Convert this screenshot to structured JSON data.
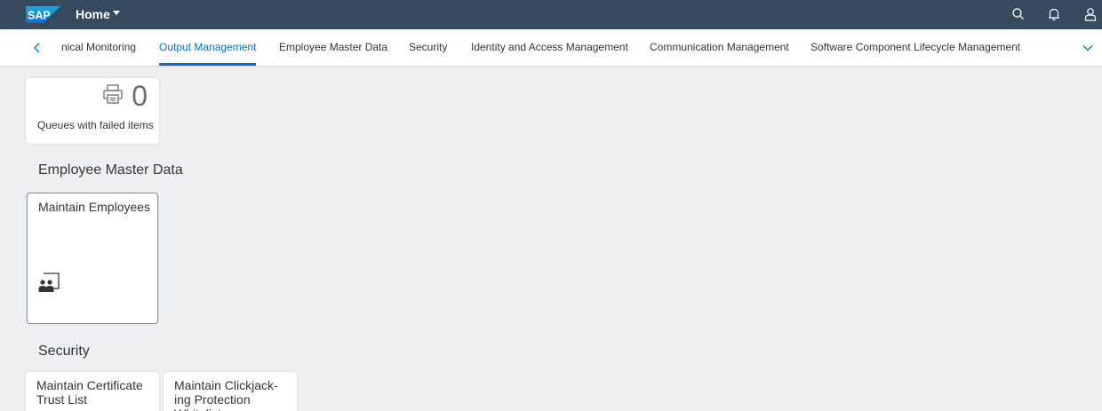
{
  "shell": {
    "logo_text": "SAP",
    "title": "Home",
    "icons": [
      "search-icon",
      "bell-icon",
      "user-icon"
    ]
  },
  "tabs": {
    "items": [
      {
        "label": "nical Monitoring"
      },
      {
        "label": "Output Management"
      },
      {
        "label": "Employee Master Data"
      },
      {
        "label": "Security"
      },
      {
        "label": "Identity and Access Management"
      },
      {
        "label": "Communication Management"
      },
      {
        "label": "Software Component Lifecycle Management"
      }
    ],
    "active_index": 1
  },
  "output_management": {
    "queue_count": "0",
    "queue_label": "Queues with failed items"
  },
  "employee_master_data": {
    "section_title": "Employee Master Data",
    "tile_title": "Maintain Employees"
  },
  "security": {
    "section_title": "Security",
    "tiles": [
      {
        "title": "Maintain Certificate Trust List"
      },
      {
        "title": "Maintain Clickjack-ing Protection Whitelist"
      }
    ]
  },
  "colors": {
    "shell_bg": "#354a5f",
    "accent": "#0a6ed1",
    "page_bg": "#edeff0"
  }
}
